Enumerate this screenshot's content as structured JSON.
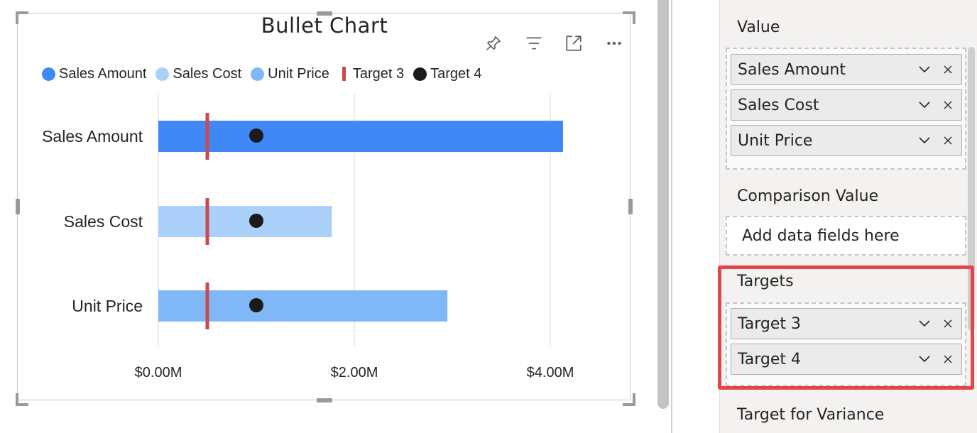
{
  "visual": {
    "title": "Bullet Chart",
    "header_icons": [
      "pin-icon",
      "filter-icon",
      "focus-mode-icon",
      "more-options-icon"
    ]
  },
  "chart_data": {
    "type": "bar",
    "title": "Bullet Chart",
    "orientation": "horizontal",
    "categories": [
      "Sales Amount",
      "Sales Cost",
      "Unit Price"
    ],
    "values": [
      4.13,
      1.77,
      2.95
    ],
    "bar_colors": [
      "#4088f6",
      "#abd0fa",
      "#80b8f7"
    ],
    "series": [
      {
        "name": "Sales Amount",
        "color": "#4088f6",
        "marker": "dot"
      },
      {
        "name": "Sales Cost",
        "color": "#abd0fa",
        "marker": "dot"
      },
      {
        "name": "Unit Price",
        "color": "#80b8f7",
        "marker": "dot"
      },
      {
        "name": "Target 3",
        "color": "#c94a4f",
        "marker": "bar",
        "values": [
          0.5,
          0.5,
          0.5
        ]
      },
      {
        "name": "Target 4",
        "color": "#1b1b1b",
        "marker": "dot",
        "values": [
          1.0,
          1.0,
          1.0
        ]
      }
    ],
    "x_ticks": [
      0,
      2,
      4
    ],
    "x_tick_labels": [
      "$0.00M",
      "$2.00M",
      "$4.00M"
    ],
    "xlim": [
      0,
      4.6
    ],
    "xlabel": "",
    "ylabel": "",
    "grid": true,
    "legend_position": "top-left"
  },
  "pane": {
    "value_label": "Value",
    "value_fields": [
      "Sales Amount",
      "Sales Cost",
      "Unit Price"
    ],
    "comparison_label": "Comparison Value",
    "comparison_placeholder": "Add data fields here",
    "targets_label": "Targets",
    "target_fields": [
      "Target 3",
      "Target 4"
    ],
    "variance_label": "Target for Variance"
  },
  "colors": {
    "highlight": "#e34549",
    "target_line": "#c94a4f",
    "target_dot": "#1b1b1b"
  }
}
